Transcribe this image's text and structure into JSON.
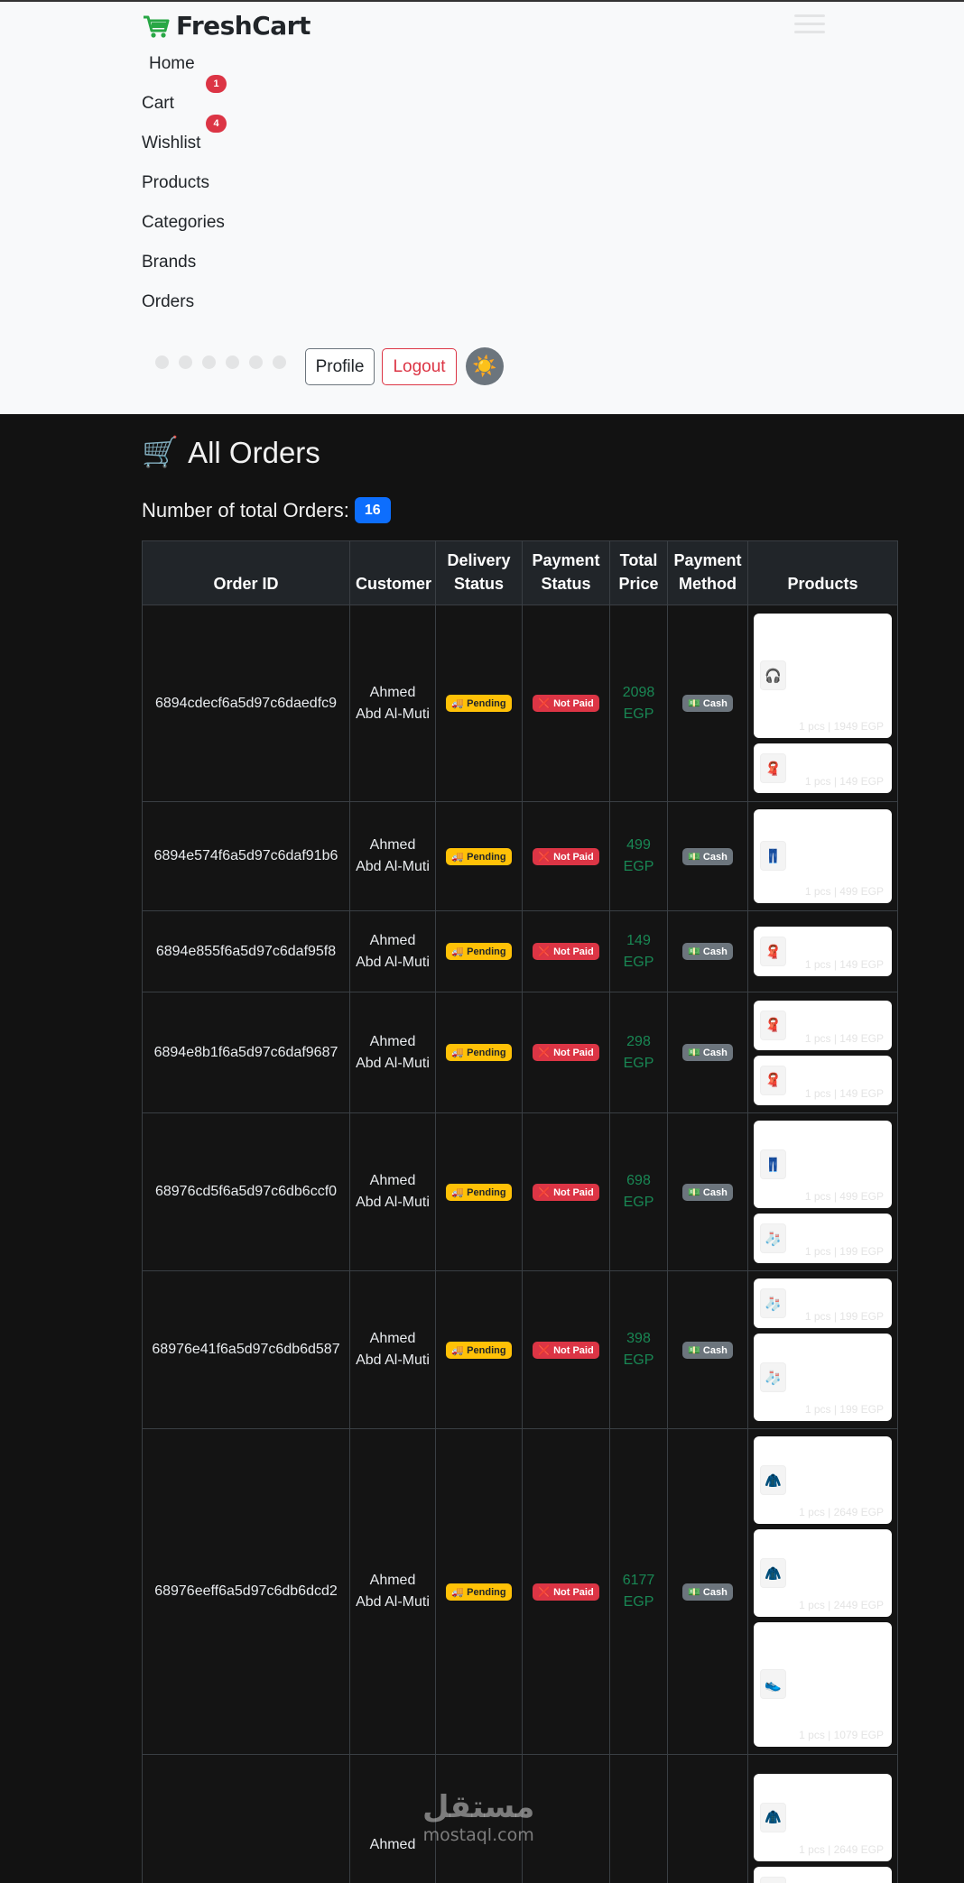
{
  "brand": {
    "name": "FreshCart"
  },
  "nav": {
    "home": "Home",
    "cart": "Cart",
    "cart_badge": "1",
    "wishlist": "Wishlist",
    "wishlist_badge": "4",
    "products": "Products",
    "categories": "Categories",
    "brands": "Brands",
    "orders": "Orders",
    "social_icons": [
      "instagram-icon",
      "facebook-icon",
      "tiktok-icon",
      "twitter-icon",
      "linkedin-icon",
      "youtube-icon"
    ],
    "profile": "Profile",
    "logout": "Logout",
    "theme_icon": "☀️"
  },
  "page": {
    "title_icon": "🛒",
    "title": "All Orders",
    "total_label": "Number of total Orders:",
    "total_count": "16"
  },
  "table": {
    "headers": [
      "Order ID",
      "Customer",
      "Delivery Status",
      "Payment Status",
      "Total Price",
      "Payment Method",
      "Products"
    ],
    "rows": [
      {
        "id": "6894cdecf6a5d97c6daedfc9",
        "customer": "Ahmed Abd Al-Muti",
        "delivery": "🚚 Pending",
        "payment": "❌ Not Paid",
        "total": "2098 EGP",
        "method": "💵 Cash",
        "products": [
          {
            "icon": "🎧",
            "qty": "1 pcs | 1949 EGP"
          },
          {
            "icon": "🧣",
            "qty": "1 pcs | 149 EGP"
          }
        ]
      },
      {
        "id": "6894e574f6a5d97c6daf91b6",
        "customer": "Ahmed Abd Al-Muti",
        "delivery": "🚚 Pending",
        "payment": "❌ Not Paid",
        "total": "499 EGP",
        "method": "💵 Cash",
        "products": [
          {
            "icon": "👖",
            "qty": "1 pcs | 499 EGP"
          }
        ]
      },
      {
        "id": "6894e855f6a5d97c6daf95f8",
        "customer": "Ahmed Abd Al-Muti",
        "delivery": "🚚 Pending",
        "payment": "❌ Not Paid",
        "total": "149 EGP",
        "method": "💵 Cash",
        "products": [
          {
            "icon": "🧣",
            "qty": "1 pcs | 149 EGP"
          }
        ]
      },
      {
        "id": "6894e8b1f6a5d97c6daf9687",
        "customer": "Ahmed Abd Al-Muti",
        "delivery": "🚚 Pending",
        "payment": "❌ Not Paid",
        "total": "298 EGP",
        "method": "💵 Cash",
        "products": [
          {
            "icon": "🧣",
            "qty": "1 pcs | 149 EGP"
          },
          {
            "icon": "🧣",
            "qty": "1 pcs | 149 EGP"
          }
        ]
      },
      {
        "id": "68976cd5f6a5d97c6db6ccf0",
        "customer": "Ahmed Abd Al-Muti",
        "delivery": "🚚 Pending",
        "payment": "❌ Not Paid",
        "total": "698 EGP",
        "method": "💵 Cash",
        "products": [
          {
            "icon": "👖",
            "qty": "1 pcs | 499 EGP"
          },
          {
            "icon": "🧦",
            "qty": "1 pcs | 199 EGP"
          }
        ]
      },
      {
        "id": "68976e41f6a5d97c6db6d587",
        "customer": "Ahmed Abd Al-Muti",
        "delivery": "🚚 Pending",
        "payment": "❌ Not Paid",
        "total": "398 EGP",
        "method": "💵 Cash",
        "products": [
          {
            "icon": "🧦",
            "qty": "1 pcs | 199 EGP"
          },
          {
            "icon": "🧦",
            "qty": "1 pcs | 199 EGP"
          }
        ]
      },
      {
        "id": "68976eeff6a5d97c6db6dcd2",
        "customer": "Ahmed Abd Al-Muti",
        "delivery": "🚚 Pending",
        "payment": "❌ Not Paid",
        "total": "6177 EGP",
        "method": "💵 Cash",
        "products": [
          {
            "icon": "🧥",
            "qty": "1 pcs | 2649 EGP"
          },
          {
            "icon": "🧥",
            "qty": "1 pcs | 2449 EGP"
          },
          {
            "icon": "👟",
            "qty": "1 pcs | 1079 EGP"
          }
        ]
      },
      {
        "id": "",
        "customer": "Ahmed",
        "delivery": "",
        "payment": "",
        "total": "",
        "method": "",
        "products": [
          {
            "icon": "🧥",
            "qty": "1 pcs | 2649 EGP"
          },
          {
            "icon": "",
            "qty": ""
          }
        ]
      }
    ]
  },
  "watermark": {
    "arabic": "مستقل",
    "latin": "mostaql.com"
  }
}
